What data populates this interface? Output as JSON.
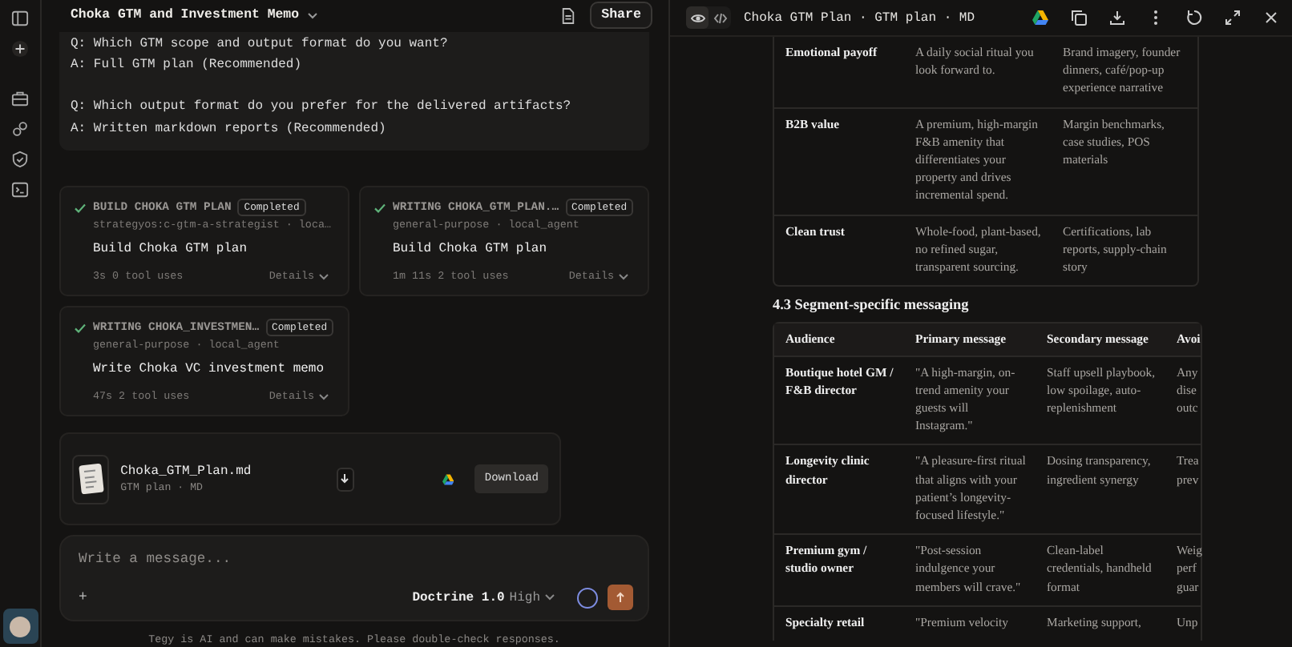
{
  "conversation": {
    "title": "Choka GTM and Investment Memo",
    "share": "Share",
    "qa": [
      {
        "q": "Q: Which GTM scope and output format do you want?",
        "a": "A: Full GTM plan (Recommended)"
      },
      {
        "q": "Q: Which output format do you prefer for the delivered artifacts?",
        "a": "A: Written markdown reports (Recommended)"
      }
    ],
    "tasks": [
      {
        "label": "BUILD CHOKA GTM PLAN",
        "status": "Completed",
        "done": true,
        "meta": "strategyos:c-gtm-a-strategist · loca…",
        "title": "Build Choka GTM plan",
        "stats": "3s 0 tool uses",
        "details": "Details"
      },
      {
        "label": "WRITING CHOKA_GTM_PLAN.…",
        "status": "Completed",
        "done": true,
        "meta": "general-purpose · local_agent",
        "title": "Build Choka GTM plan",
        "stats": "1m 11s 2 tool uses",
        "details": "Details"
      },
      {
        "label": "WRITING CHOKA_INVESTMEN…",
        "status": "Completed",
        "done": true,
        "meta": "general-purpose · local_agent",
        "title": "Write Choka VC investment memo",
        "stats": "47s 2 tool uses",
        "details": "Details"
      }
    ],
    "file": {
      "name": "Choka_GTM_Plan.md",
      "meta": "GTM plan · MD",
      "download": "Download"
    },
    "composer": {
      "placeholder": "Write a message...",
      "add": "+",
      "model": "Doctrine 1.0",
      "effort": "High"
    },
    "disclaimer": "Tegy is AI and can make mistakes. Please double-check responses."
  },
  "preview": {
    "modes": [
      {
        "kind": "preview",
        "selected": true
      },
      {
        "kind": "code",
        "selected": false
      }
    ],
    "title": "Choka GTM Plan · GTM plan · MD",
    "table_1": {
      "rows": [
        [
          "Emotional payoff",
          "A daily social ritual you look forward to.",
          "Brand imagery, founder dinners, café/pop-up experience narrative"
        ],
        [
          "B2B value",
          "A premium, high-margin F&B amenity that differentiates your property and drives incremental spend.",
          "Margin benchmarks, case studies, POS materials"
        ],
        [
          "Clean trust",
          "Whole-food, plant-based, no refined sugar, transparent sourcing.",
          "Certifications, lab reports, supply-chain story"
        ]
      ]
    },
    "heading": "4.3 Segment-specific messaging",
    "table_2": {
      "columns": [
        "Audience",
        "Primary message",
        "Secondary message",
        "Avoi"
      ],
      "rows": [
        {
          "cells": [
            "Boutique hotel GM / F&B director",
            "\"A high-margin, on-trend amenity your guests will Instagram.\"",
            "Staff upsell playbook, low spoilage, auto-replenishment"
          ],
          "column_4": [
            "Any",
            "dise",
            "outc"
          ]
        },
        {
          "cells": [
            "Longevity clinic director",
            "\"A pleasure-first ritual that aligns with your patient’s longevity-focused lifestyle.\"",
            "Dosing transparency, ingredient synergy"
          ],
          "column_4": [
            "Trea",
            "prev"
          ]
        },
        {
          "cells": [
            "Premium gym / studio owner",
            "\"Post-session indulgence your members will crave.\"",
            "Clean-label credentials, handheld format"
          ],
          "column_4": [
            "Weig",
            "perf",
            "guar"
          ]
        },
        {
          "cells": [
            "Specialty retail",
            "\"Premium velocity",
            "Marketing support,"
          ],
          "column_4": [
            "Unp"
          ]
        }
      ]
    }
  }
}
